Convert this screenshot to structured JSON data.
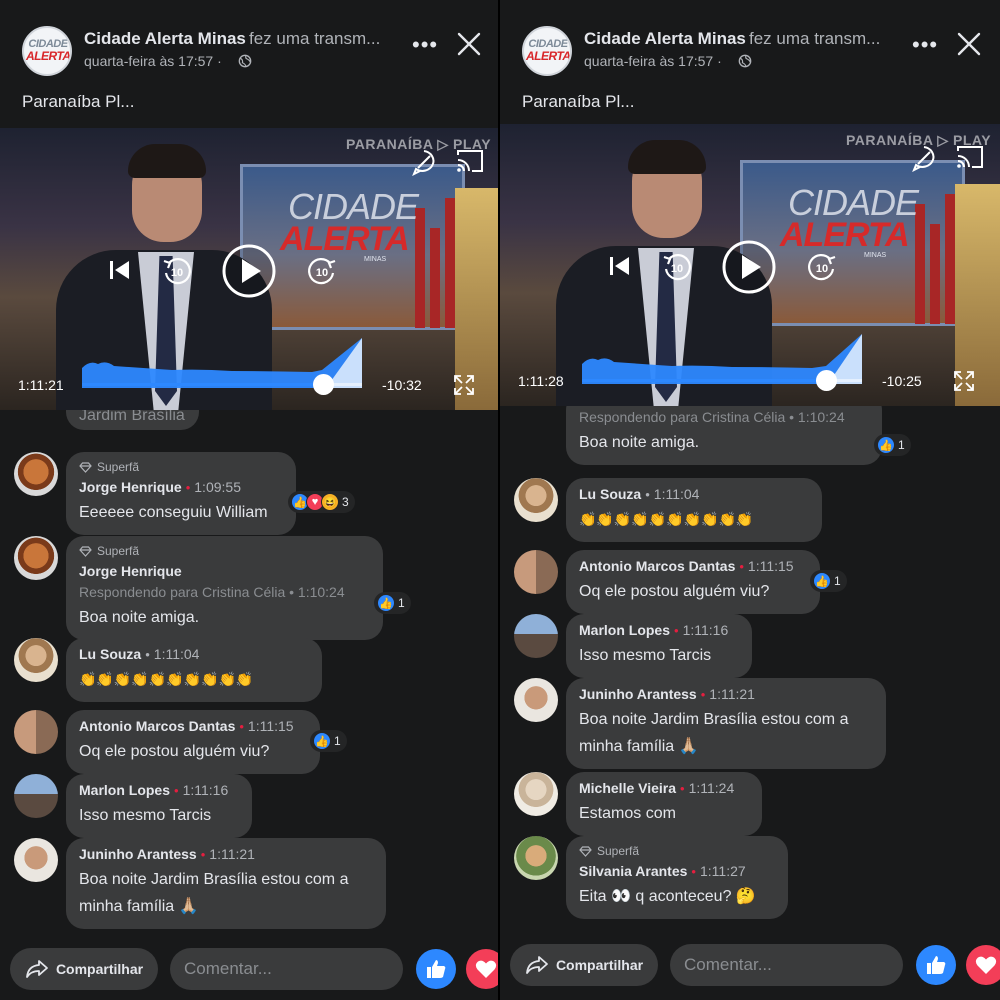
{
  "left": {
    "page_name": "Cidade Alerta Minas",
    "page_action": "fez uma transm...",
    "post_time": "quarta-feira às 17:57 ·",
    "post_text": "Paranaíba Pl...",
    "video": {
      "watermark": "PARANAÍBA ▷ PLAY",
      "screen_text_1": "CIDADE",
      "screen_text_2": "ALERTA",
      "screen_text_3": "MINAS",
      "elapsed": "1:11:21",
      "remaining": "-10:32",
      "progress": 0.86
    },
    "partial_text": "Jardim Brasília",
    "comments": [
      {
        "badge": "Superfã",
        "author": "Jorge Henrique",
        "time": "1:09:55",
        "reply_to": "",
        "text": "Eeeeee conseguiu William",
        "reactions": [
          "like",
          "love",
          "haha"
        ],
        "count": "3"
      },
      {
        "badge": "Superfã",
        "author": "Jorge Henrique",
        "time": "1:10:24",
        "reply_to": "Respondendo para Cristina Célia • 1:10:24",
        "text": "Boa noite amiga.",
        "reactions": [
          "like"
        ],
        "count": "1"
      },
      {
        "badge": "",
        "author": "Lu Souza",
        "time": "1:11:04",
        "reply_to": "",
        "text": "👏👏👏👏👏👏👏👏👏👏",
        "reactions": [],
        "count": ""
      },
      {
        "badge": "",
        "author": "Antonio Marcos Dantas",
        "time": "1:11:15",
        "reply_to": "",
        "text": "Oq ele postou alguém viu?",
        "reactions": [
          "like"
        ],
        "count": "1"
      },
      {
        "badge": "",
        "author": "Marlon Lopes",
        "time": "1:11:16",
        "reply_to": "",
        "text": "Isso mesmo Tarcis",
        "reactions": [],
        "count": ""
      },
      {
        "badge": "",
        "author": "Juninho Arantess",
        "time": "1:11:21",
        "reply_to": "",
        "text": "Boa noite Jardim Brasília estou com a",
        "text2": "minha família 🙏🏼",
        "reactions": [],
        "count": ""
      }
    ],
    "share_label": "Compartilhar",
    "comment_placeholder": "Comentar..."
  },
  "right": {
    "page_name": "Cidade Alerta Minas",
    "page_action": "fez uma transm...",
    "post_time": "quarta-feira às 17:57 ·",
    "post_text": "Paranaíba Pl...",
    "video": {
      "watermark": "PARANAÍBA ▷ PLAY",
      "screen_text_1": "CIDADE",
      "screen_text_2": "ALERTA",
      "screen_text_3": "MINAS",
      "elapsed": "1:11:28",
      "remaining": "-10:25",
      "progress": 0.87
    },
    "comments": [
      {
        "badge": "",
        "author": "",
        "time": "",
        "reply_to": "Respondendo para Cristina Célia • 1:10:24",
        "text": "Boa noite amiga.",
        "reactions": [
          "like"
        ],
        "count": "1"
      },
      {
        "badge": "",
        "author": "Lu Souza",
        "time": "1:11:04",
        "reply_to": "",
        "text": "👏👏👏👏👏👏👏👏👏👏",
        "reactions": [],
        "count": ""
      },
      {
        "badge": "",
        "author": "Antonio Marcos Dantas",
        "time": "1:11:15",
        "reply_to": "",
        "text": "Oq ele postou alguém viu?",
        "reactions": [
          "like"
        ],
        "count": "1"
      },
      {
        "badge": "",
        "author": "Marlon Lopes",
        "time": "1:11:16",
        "reply_to": "",
        "text": "Isso mesmo Tarcis",
        "reactions": [],
        "count": ""
      },
      {
        "badge": "",
        "author": "Juninho Arantess",
        "time": "1:11:21",
        "reply_to": "",
        "text": "Boa noite Jardim Brasília estou com a",
        "text2": "minha família 🙏🏼",
        "reactions": [],
        "count": ""
      },
      {
        "badge": "",
        "author": "Michelle Vieira",
        "time": "1:11:24",
        "reply_to": "",
        "text": "Estamos com",
        "reactions": [],
        "count": ""
      },
      {
        "badge": "Superfã",
        "author": "Silvania Arantes",
        "time": "1:11:27",
        "reply_to": "",
        "text": "Eita 👀 q aconteceu? 🤔",
        "reactions": [],
        "count": ""
      }
    ],
    "share_label": "Compartilhar",
    "comment_placeholder": "Comentar..."
  },
  "colors": {
    "background": "#18191a",
    "bubble": "#3a3b3c",
    "accent_blue": "#2d88ff",
    "love_red": "#f33e58",
    "dot_red": "#e41e3f"
  }
}
